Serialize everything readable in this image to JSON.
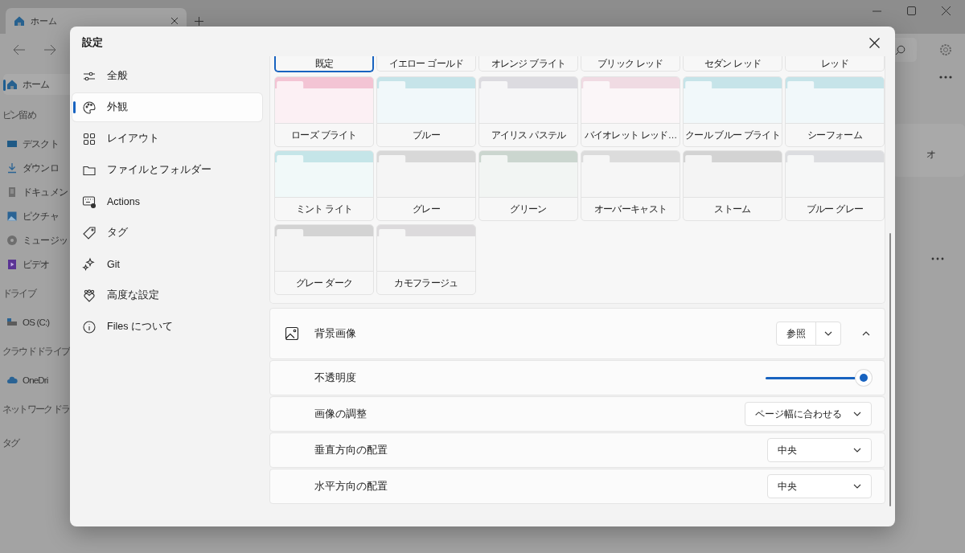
{
  "window": {
    "tab_title": "ホーム"
  },
  "sidebar": [
    {
      "kind": "home",
      "label": "ホーム",
      "selected": true
    },
    {
      "kind": "header",
      "label": "ピン留め"
    },
    {
      "kind": "desktop",
      "label": "デスクト",
      "selected": false
    },
    {
      "kind": "download",
      "label": "ダウンロ",
      "selected": false
    },
    {
      "kind": "document",
      "label": "ドキュメン",
      "selected": false
    },
    {
      "kind": "picture",
      "label": "ピクチャ",
      "selected": false
    },
    {
      "kind": "music",
      "label": "ミュージッ",
      "selected": false
    },
    {
      "kind": "video",
      "label": "ビデオ",
      "selected": false
    },
    {
      "kind": "header",
      "label": "ドライブ"
    },
    {
      "kind": "drive",
      "label": "OS (C:)",
      "selected": false
    },
    {
      "kind": "header",
      "label": "クラウド ドライブ"
    },
    {
      "kind": "cloud",
      "label": "OneDri",
      "selected": false
    },
    {
      "kind": "header",
      "label": "ネットワーク ドラ"
    },
    {
      "kind": "header",
      "label": "タグ"
    }
  ],
  "main": {
    "card_label": "オ"
  },
  "settings": {
    "title": "設定",
    "nav": [
      {
        "kind": "sliders",
        "label": "全般",
        "selected": false
      },
      {
        "kind": "palette",
        "label": "外観",
        "selected": true
      },
      {
        "kind": "grid",
        "label": "レイアウト",
        "selected": false
      },
      {
        "kind": "folder",
        "label": "ファイルとフォルダー",
        "selected": false
      },
      {
        "kind": "keyboard",
        "label": "Actions",
        "selected": false
      },
      {
        "kind": "tag",
        "label": "タグ",
        "selected": false
      },
      {
        "kind": "sparkle",
        "label": "Git",
        "selected": false
      },
      {
        "kind": "hearts",
        "label": "高度な設定",
        "selected": false
      },
      {
        "kind": "info",
        "label": "Files について",
        "selected": false
      }
    ],
    "themes": [
      {
        "label": "既定",
        "selected": true
      },
      {
        "label": "イエロー ゴールド",
        "selected": false
      },
      {
        "label": "オレンジ ブライト",
        "selected": false
      },
      {
        "label": "ブリック レッド",
        "selected": false
      },
      {
        "label": "セダン レッド",
        "selected": false
      },
      {
        "label": "レッド",
        "selected": false
      },
      {
        "label": "ローズ ブライト",
        "selected": false,
        "color": "#f3c4d4"
      },
      {
        "label": "ブルー",
        "selected": false,
        "color": "#c6e4e9"
      },
      {
        "label": "アイリス パステル",
        "selected": false,
        "color": "#dcdbe0"
      },
      {
        "label": "バイオレット レッド…",
        "selected": false,
        "color": "#f0dbe3"
      },
      {
        "label": "クール ブルー ブライト",
        "selected": false,
        "color": "#c6e4e9"
      },
      {
        "label": "シーフォーム",
        "selected": false,
        "color": "#c6e4e9"
      },
      {
        "label": "ミント ライト",
        "selected": false,
        "color": "#c5e5e8"
      },
      {
        "label": "グレー",
        "selected": false,
        "color": "#d8d8d8"
      },
      {
        "label": "グリーン",
        "selected": false,
        "color": "#cbd6cf"
      },
      {
        "label": "オーバーキャスト",
        "selected": false,
        "color": "#dcdcdc"
      },
      {
        "label": "ストーム",
        "selected": false,
        "color": "#d3d3d3"
      },
      {
        "label": "ブルー グレー",
        "selected": false,
        "color": "#dcdde0"
      },
      {
        "label": "グレー ダーク",
        "selected": false,
        "color": "#d3d3d3"
      },
      {
        "label": "カモフラージュ",
        "selected": false,
        "color": "#dcdadc"
      }
    ],
    "background_image": {
      "title": "背景画像",
      "browse": "参照",
      "expanded": true,
      "rows": [
        {
          "kind": "slider",
          "label": "不透明度",
          "level": 1.0
        },
        {
          "kind": "dropdown",
          "label": "画像の調整",
          "value": "ページ幅に合わせる"
        },
        {
          "kind": "dropdown",
          "label": "垂直方向の配置",
          "value": "中央"
        },
        {
          "kind": "dropdown",
          "label": "水平方向の配置",
          "value": "中央"
        }
      ]
    }
  }
}
